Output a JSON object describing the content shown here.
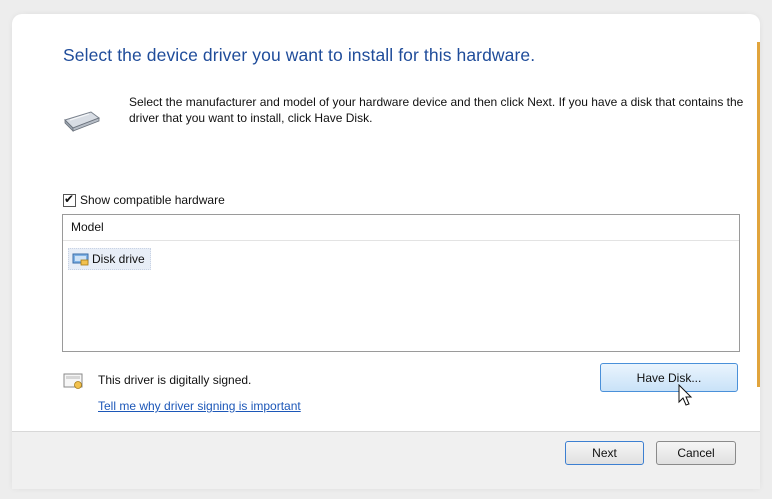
{
  "dialog": {
    "heading": "Select the device driver you want to install for this hardware.",
    "instructions": "Select the manufacturer and model of your hardware device and then click Next. If you have a disk that contains the driver that you want to install, click Have Disk.",
    "hardware_icon": "disk-drive-icon"
  },
  "compat": {
    "label": "Show compatible hardware",
    "checked": true
  },
  "model_list": {
    "header": "Model",
    "items": [
      {
        "label": "Disk drive",
        "icon": "disk-drive-icon",
        "selected": true
      }
    ]
  },
  "signing": {
    "status": "This driver is digitally signed.",
    "link": "Tell me why driver signing is important",
    "icon": "signed-driver-icon"
  },
  "buttons": {
    "have_disk": "Have Disk...",
    "next": "Next",
    "cancel": "Cancel"
  },
  "colors": {
    "heading": "#1f4c9a",
    "link": "#1c57b8",
    "selection": "#e8eef7",
    "accent_strip": "#e1a43c"
  }
}
